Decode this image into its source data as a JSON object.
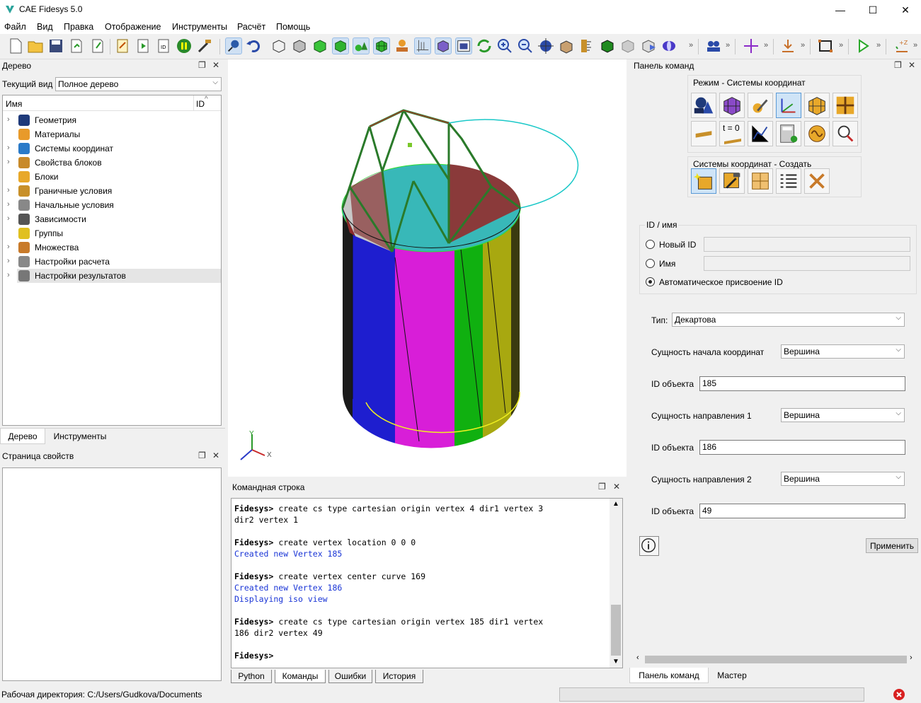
{
  "window": {
    "title": "CAE Fidesys 5.0",
    "min": "—",
    "max": "☐",
    "close": "✕"
  },
  "menu": [
    "Файл",
    "Вид",
    "Правка",
    "Отображение",
    "Инструменты",
    "Расчёт",
    "Помощь"
  ],
  "toolbar": {
    "overflow": "»"
  },
  "tree_dock": {
    "title": "Дерево",
    "current_view_label": "Текущий вид",
    "current_view_value": "Полное дерево",
    "col_name": "Имя",
    "col_id": "ID",
    "items": [
      {
        "label": "Геометрия",
        "icon": "geometry-icon",
        "expandable": true
      },
      {
        "label": "Материалы",
        "icon": "materials-icon",
        "expandable": false
      },
      {
        "label": "Системы координат",
        "icon": "coord-systems-icon",
        "expandable": true
      },
      {
        "label": "Свойства блоков",
        "icon": "block-properties-icon",
        "expandable": true
      },
      {
        "label": "Блоки",
        "icon": "blocks-icon",
        "expandable": false
      },
      {
        "label": "Граничные условия",
        "icon": "boundary-conditions-icon",
        "expandable": true
      },
      {
        "label": "Начальные условия",
        "icon": "initial-conditions-icon",
        "expandable": true
      },
      {
        "label": "Зависимости",
        "icon": "dependencies-icon",
        "expandable": true
      },
      {
        "label": "Группы",
        "icon": "groups-icon",
        "expandable": false
      },
      {
        "label": "Множества",
        "icon": "sets-icon",
        "expandable": true
      },
      {
        "label": "Настройки расчета",
        "icon": "calc-settings-icon",
        "expandable": true
      },
      {
        "label": "Настройки результатов",
        "icon": "results-settings-icon",
        "expandable": true
      }
    ],
    "tabs": [
      "Дерево",
      "Инструменты"
    ]
  },
  "props_dock": {
    "title": "Страница свойств"
  },
  "viewport": {
    "axis_x": "X",
    "axis_y": "Y"
  },
  "console": {
    "title": "Командная строка",
    "lines": [
      {
        "t": "Fidesys> create cs type cartesian origin vertex 4 dir1 vertex 3",
        "c": "cmd"
      },
      {
        "t": "dir2 vertex 1",
        "c": "cmd"
      },
      {
        "t": "",
        "c": "cmd"
      },
      {
        "t": "Fidesys> create vertex location 0 0 0",
        "c": "cmd"
      },
      {
        "t": "Created new Vertex 185",
        "c": "out"
      },
      {
        "t": "",
        "c": "cmd"
      },
      {
        "t": "Fidesys> create vertex center curve 169",
        "c": "cmd"
      },
      {
        "t": "Created new Vertex 186",
        "c": "out"
      },
      {
        "t": "Displaying iso view",
        "c": "out"
      },
      {
        "t": "",
        "c": "cmd"
      },
      {
        "t": "Fidesys> create cs type cartesian origin vertex 185 dir1 vertex",
        "c": "cmd"
      },
      {
        "t": "186 dir2 vertex 49",
        "c": "cmd"
      },
      {
        "t": "",
        "c": "cmd"
      },
      {
        "t": "Fidesys>",
        "c": "cmd"
      }
    ],
    "tabs": [
      "Python",
      "Команды",
      "Ошибки",
      "История"
    ]
  },
  "command_panel": {
    "title": "Панель команд",
    "mode_title": "Режим - Системы координат",
    "create_title": "Системы координат - Создать",
    "t0_label": "t = 0",
    "id_group": "ID / имя",
    "new_id": "Новый ID",
    "name": "Имя",
    "auto_id": "Автоматическое присвоение ID",
    "type_label": "Тип:",
    "type_value": "Декартова",
    "origin_label": "Сущность начала координат",
    "origin_value": "Вершина",
    "obj_id_label": "ID объекта",
    "origin_id": "185",
    "dir1_label": "Сущность направления 1",
    "dir1_value": "Вершина",
    "dir1_id": "186",
    "dir2_label": "Сущность направления 2",
    "dir2_value": "Вершина",
    "dir2_id": "49",
    "apply": "Применить",
    "tabs": [
      "Панель команд",
      "Мастер"
    ]
  },
  "statusbar": {
    "workdir": "Рабочая директория: C:/Users/Gudkova/Documents"
  }
}
